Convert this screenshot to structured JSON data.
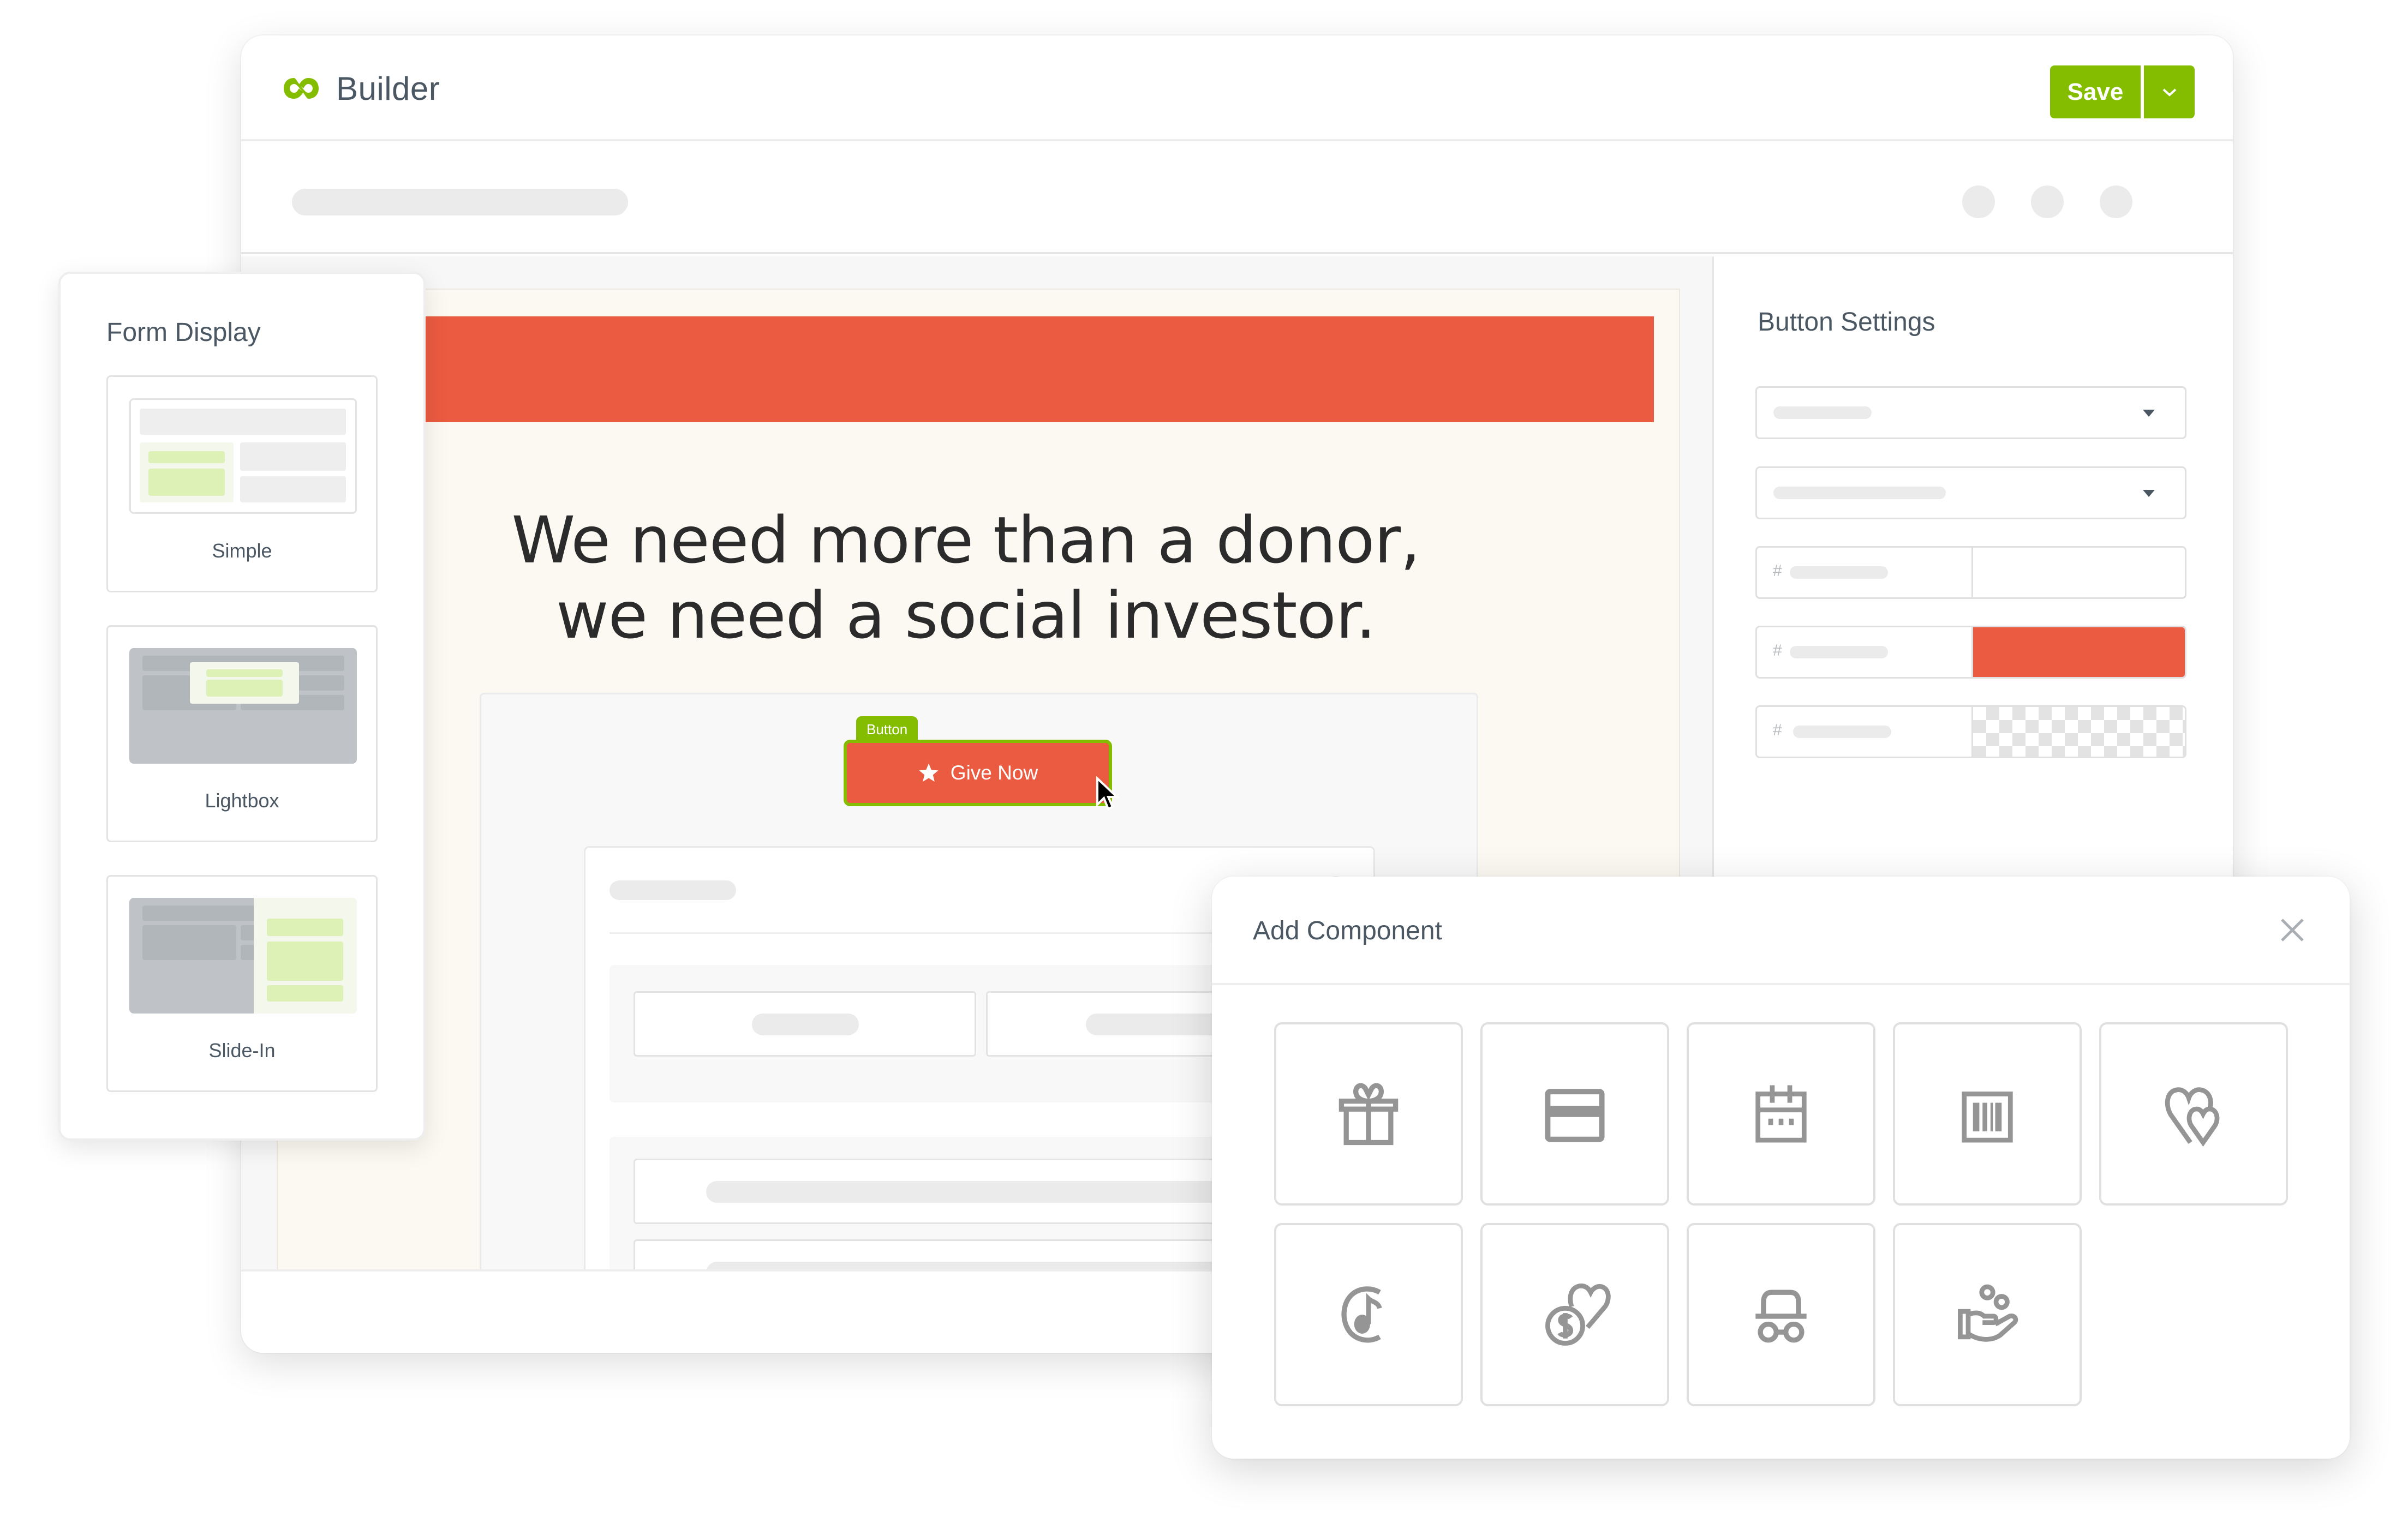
{
  "app": {
    "title": "Builder",
    "brand_color": "#84bd00",
    "accent_color": "#ea5b41"
  },
  "header": {
    "save_label": "Save",
    "save_menu_icon": "chevron-down-icon"
  },
  "canvas": {
    "headline_line1": "We need more than a donor,",
    "headline_line2": "we need a social investor.",
    "selected_element_tag": "Button",
    "donate_button_label": "Give Now",
    "donate_button_icon": "star-icon"
  },
  "button_settings": {
    "title": "Button Settings",
    "color_prefix": "#",
    "stepper_minus": "−",
    "stepper_plus": "+",
    "background_color": "#ea5b41"
  },
  "form_display": {
    "title": "Form Display",
    "options": [
      {
        "label": "Simple"
      },
      {
        "label": "Lightbox"
      },
      {
        "label": "Slide-In"
      }
    ]
  },
  "add_component": {
    "title": "Add Component",
    "close_icon": "close-icon",
    "components": [
      {
        "icon": "gift-icon"
      },
      {
        "icon": "credit-card-icon"
      },
      {
        "icon": "calendar-icon"
      },
      {
        "icon": "barcode-icon"
      },
      {
        "icon": "hearts-icon"
      },
      {
        "icon": "music-note-icon"
      },
      {
        "icon": "donation-heart-icon"
      },
      {
        "icon": "incognito-icon"
      },
      {
        "icon": "giving-hand-icon"
      }
    ]
  }
}
